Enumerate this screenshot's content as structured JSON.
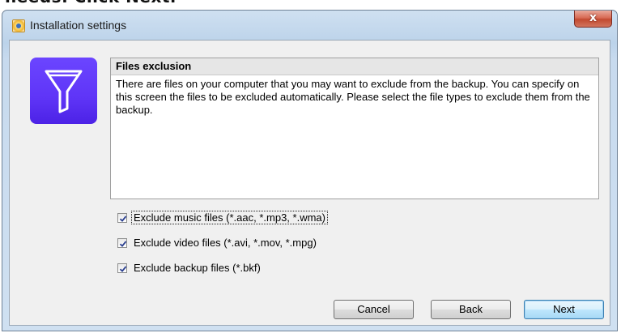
{
  "caption": {
    "text": "needs. Click Next."
  },
  "window": {
    "title": "Installation settings",
    "close_glyph": "x"
  },
  "icons": {
    "app": "setup-app-icon",
    "hero": "funnel-filter-icon",
    "close": "close-icon",
    "check": "checkmark-icon"
  },
  "panel": {
    "heading": "Files exclusion",
    "text": "There are files on your computer that you may want to exclude from the backup. You can specify on this screen the files to be excluded automatically. Please select the file types to exclude them from the backup."
  },
  "options": [
    {
      "label": "Exclude music files (*.aac, *.mp3, *.wma)",
      "checked": true,
      "focused": true
    },
    {
      "label": "Exclude video files (*.avi, *.mov, *.mpg)",
      "checked": true,
      "focused": false
    },
    {
      "label": "Exclude backup files (*.bkf)",
      "checked": true,
      "focused": false
    }
  ],
  "buttons": {
    "cancel": "Cancel",
    "back": "Back",
    "next": "Next"
  },
  "colors": {
    "hero_tile": "#5f35f7",
    "close_button": "#c24a30",
    "default_button_border": "#3c7fb1"
  }
}
